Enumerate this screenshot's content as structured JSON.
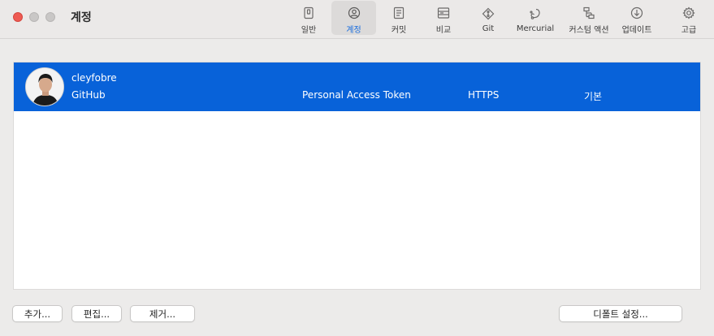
{
  "window": {
    "title": "계정"
  },
  "toolbar": {
    "items": [
      {
        "label": "일반",
        "icon": "general-icon"
      },
      {
        "label": "계정",
        "icon": "account-icon",
        "active": true
      },
      {
        "label": "커밋",
        "icon": "commit-icon"
      },
      {
        "label": "비교",
        "icon": "diff-icon"
      },
      {
        "label": "Git",
        "icon": "git-icon"
      },
      {
        "label": "Mercurial",
        "icon": "mercurial-icon"
      },
      {
        "label": "커스텀 액션",
        "icon": "custom-actions-icon"
      },
      {
        "label": "업데이트",
        "icon": "update-icon"
      },
      {
        "label": "고급",
        "icon": "advanced-gear-icon"
      }
    ],
    "accent_color": "#1d6fde"
  },
  "accounts": [
    {
      "username": "cleyfobre",
      "host": "GitHub",
      "auth": "Personal Access Token",
      "protocol": "HTTPS",
      "default": "기본",
      "selected": true
    }
  ],
  "selection_color": "#0862d9",
  "buttons": {
    "add": "추가...",
    "edit": "편집...",
    "remove": "제거...",
    "set_default": "디폴트 설정..."
  }
}
